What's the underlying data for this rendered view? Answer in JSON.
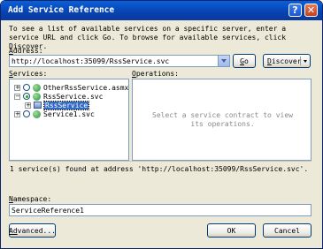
{
  "window": {
    "title": "Add Service Reference",
    "help": "?",
    "close": "✕"
  },
  "intro": "To see a list of available services on a specific server, enter a service URL and click Go. To browse for available services, click Discover.",
  "address": {
    "label_u": "A",
    "label_rest": "ddress:",
    "value": "http://localhost:35099/RssService.svc"
  },
  "buttons": {
    "go_u": "G",
    "go_rest": "o",
    "discover_u": "D",
    "discover_rest": "iscover",
    "advanced_u": "Ad",
    "advanced_rest": "vanced...",
    "ok": "OK",
    "cancel": "Cancel"
  },
  "services": {
    "label_u": "S",
    "label_rest": "ervices:",
    "items": [
      {
        "toggle": "+",
        "label": "OtherRssService.asmx"
      },
      {
        "toggle": "−",
        "label": "RssService.svc"
      },
      {
        "toggle": "+",
        "label": "RssService",
        "selected": true
      },
      {
        "toggle": "+",
        "label": "Service1.svc"
      }
    ]
  },
  "operations": {
    "label_u": "O",
    "label_rest": "perations:",
    "placeholder": "Select a service contract to view its operations."
  },
  "status": "1 service(s) found at address 'http://localhost:35099/RssService.svc'.",
  "namespace": {
    "label_u": "N",
    "label_rest": "amespace:",
    "value": "ServiceReference1"
  },
  "colors": {
    "title_bar": "#0a4fd0",
    "dialog_bg": "#ece9d8",
    "selection": "#316ac5"
  }
}
